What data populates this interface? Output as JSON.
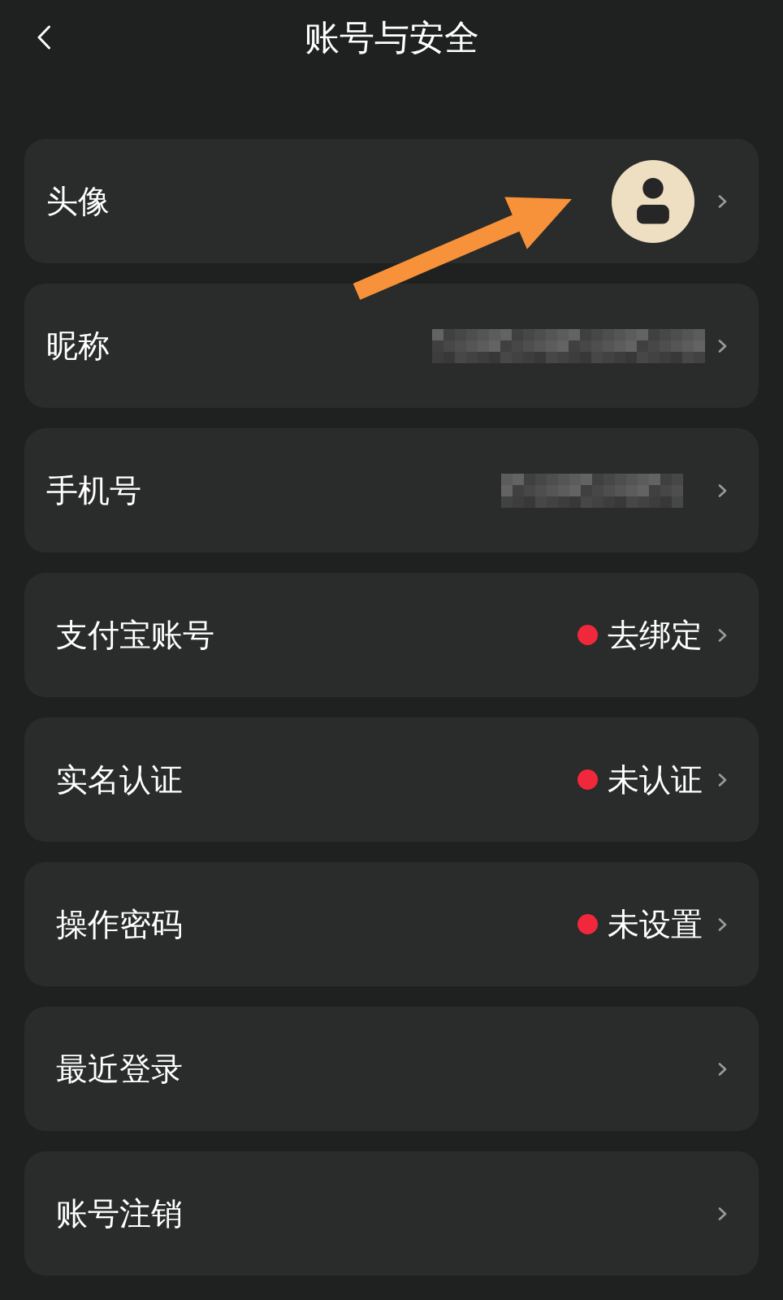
{
  "header": {
    "title": "账号与安全"
  },
  "items": [
    {
      "kind": "avatar",
      "label": "头像"
    },
    {
      "kind": "redacted",
      "label": "昵称"
    },
    {
      "kind": "redacted",
      "label": "手机号"
    },
    {
      "kind": "status",
      "label": "支付宝账号",
      "value": "去绑定",
      "alert": true
    },
    {
      "kind": "status",
      "label": "实名认证",
      "value": "未认证",
      "alert": true
    },
    {
      "kind": "status",
      "label": "操作密码",
      "value": "未设置",
      "alert": true
    },
    {
      "kind": "link",
      "label": "最近登录"
    },
    {
      "kind": "link",
      "label": "账号注销"
    }
  ]
}
